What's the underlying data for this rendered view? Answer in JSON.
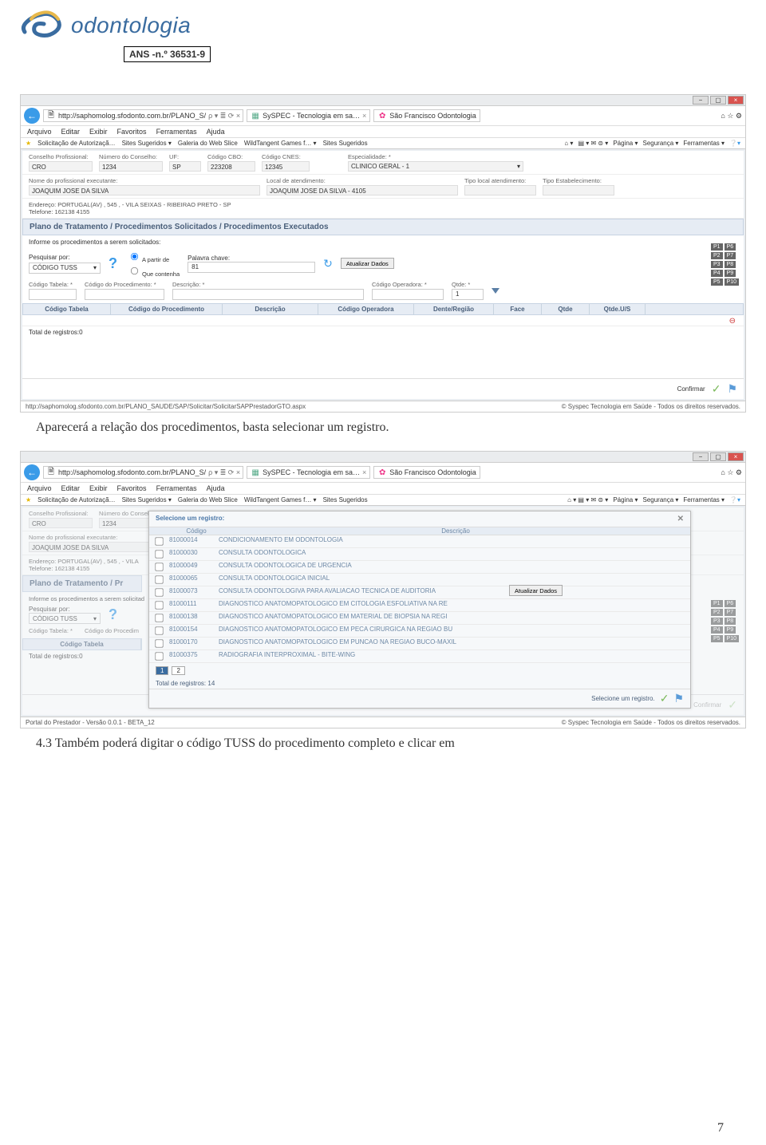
{
  "header": {
    "brand": "odontologia",
    "ans": "ANS -n.º 36531-9"
  },
  "window": {
    "browser_url": "http://saphomolog.sfodonto.com.br/PLANO_S/",
    "tab1": "SySPEC - Tecnologia em sa…",
    "tab2": "São Francisco Odontologia",
    "menus": [
      "Arquivo",
      "Editar",
      "Exibir",
      "Favoritos",
      "Ferramentas",
      "Ajuda"
    ],
    "favs": [
      "Solicitação de Autorizaçã…",
      "Sites Sugeridos ▾",
      "Galeria do Web Slice",
      "WildTangent Games f… ▾",
      "Sites Sugeridos"
    ],
    "toolbar_right": [
      "Página ▾",
      "Segurança ▾",
      "Ferramentas ▾"
    ]
  },
  "form": {
    "conselho_label": "Conselho Profissional:",
    "conselho": "CRO",
    "num_label": "Número do Conselho:",
    "num": "1234",
    "uf_label": "UF:",
    "uf": "SP",
    "cbo_label": "Código CBO:",
    "cbo": "223208",
    "cnes_label": "Código CNES:",
    "cnes": "12345",
    "esp_label": "Especialidade: *",
    "esp": "CLINICO GERAL - 1",
    "nome_label": "Nome do profissional executante:",
    "nome": "JOAQUIM JOSE DA SILVA",
    "local_label": "Local de atendimento:",
    "local": "JOAQUIM JOSE DA SILVA - 4105",
    "tipo_local_label": "Tipo local atendimento:",
    "tipo_estab_label": "Tipo Estabelecimento:",
    "endereco_label": "Endereço:",
    "endereco": "PORTUGAL(AV) , 545 , - VILA SEIXAS - RIBEIRAO PRETO - SP",
    "telefone_label": "Telefone:",
    "telefone": "162138 4155"
  },
  "section": {
    "title": "Plano de Tratamento / Procedimentos Solicitados / Procedimentos Executados",
    "hint": "Informe os procedimentos a serem solicitados:",
    "pesq_label": "Pesquisar por:",
    "pesq_val": "CÓDIGO TUSS",
    "radio1": "A partir de",
    "radio2": "Que contenha",
    "palavra_label": "Palavra chave:",
    "palavra_val": "81",
    "btn_atualizar": "Atualizar Dados",
    "cod_tabela_label": "Código Tabela: *",
    "cod_proc_label": "Código do Procedimento: *",
    "desc_label": "Descrição: *",
    "cod_op_label": "Código Operadora: *",
    "qtde_label": "Qtde: *",
    "qtde_val": "1",
    "total_label": "Total de registros:0",
    "confirmar": "Confirmar"
  },
  "columns": [
    "Código Tabela",
    "Código do Procedimento",
    "Descrição",
    "Código Operadora",
    "Dente/Região",
    "Face",
    "Qtde",
    "Qtde.U/S"
  ],
  "badges": [
    [
      "P1",
      "P6"
    ],
    [
      "P2",
      "P7"
    ],
    [
      "P3",
      "P8"
    ],
    [
      "P4",
      "P9"
    ],
    [
      "P5",
      "P10"
    ]
  ],
  "status": {
    "left": "http://saphomolog.sfodonto.com.br/PLANO_SAUDE/SAP/Solicitar/SolicitarSAPPrestadorGTO.aspx",
    "right": "© Syspec Tecnologia em Saúde - Todos os direitos reservados.",
    "left2": "Portal do Prestador - Versão 0.0.1 - BETA_12"
  },
  "caption1": "Aparecerá a relação dos procedimentos, basta selecionar um registro.",
  "caption2": "4.3 Também poderá digitar o código TUSS do procedimento completo e clicar em",
  "modal": {
    "title": "Selecione um registro:",
    "col_code": "Código",
    "col_desc": "Descrição",
    "rows": [
      {
        "c": "81000014",
        "d": "CONDICIONAMENTO EM ODONTOLOGIA"
      },
      {
        "c": "81000030",
        "d": "CONSULTA ODONTOLOGICA"
      },
      {
        "c": "81000049",
        "d": "CONSULTA ODONTOLOGICA DE URGENCIA"
      },
      {
        "c": "81000065",
        "d": "CONSULTA ODONTOLOGICA INICIAL"
      },
      {
        "c": "81000073",
        "d": "CONSULTA ODONTOLOGIVA PARA AVALIACAO TECNICA DE AUDITORIA"
      },
      {
        "c": "81000111",
        "d": "DIAGNOSTICO ANATOMOPATOLOGICO EM CITOLOGIA ESFOLIATIVA NA RE"
      },
      {
        "c": "81000138",
        "d": "DIAGNOSTICO ANATOMOPATOLOGICO EM MATERIAL DE BIOPSIA NA REGI"
      },
      {
        "c": "81000154",
        "d": "DIAGNOSTICO ANATOMOPATOLOGICO EM PECA CIRURGICA NA REGIAO BU"
      },
      {
        "c": "81000170",
        "d": "DIAGNOSTICO ANATOMOPATOLOGICO EM PUNCAO NA REGIAO BUCO-MAXIL"
      },
      {
        "c": "81000375",
        "d": "RADIOGRAFIA INTERPROXIMAL - BITE-WING"
      }
    ],
    "pages": [
      "1",
      "2"
    ],
    "total": "Total de registros: 14",
    "footer_hint": "Selecione um registro."
  },
  "page_number": "7"
}
